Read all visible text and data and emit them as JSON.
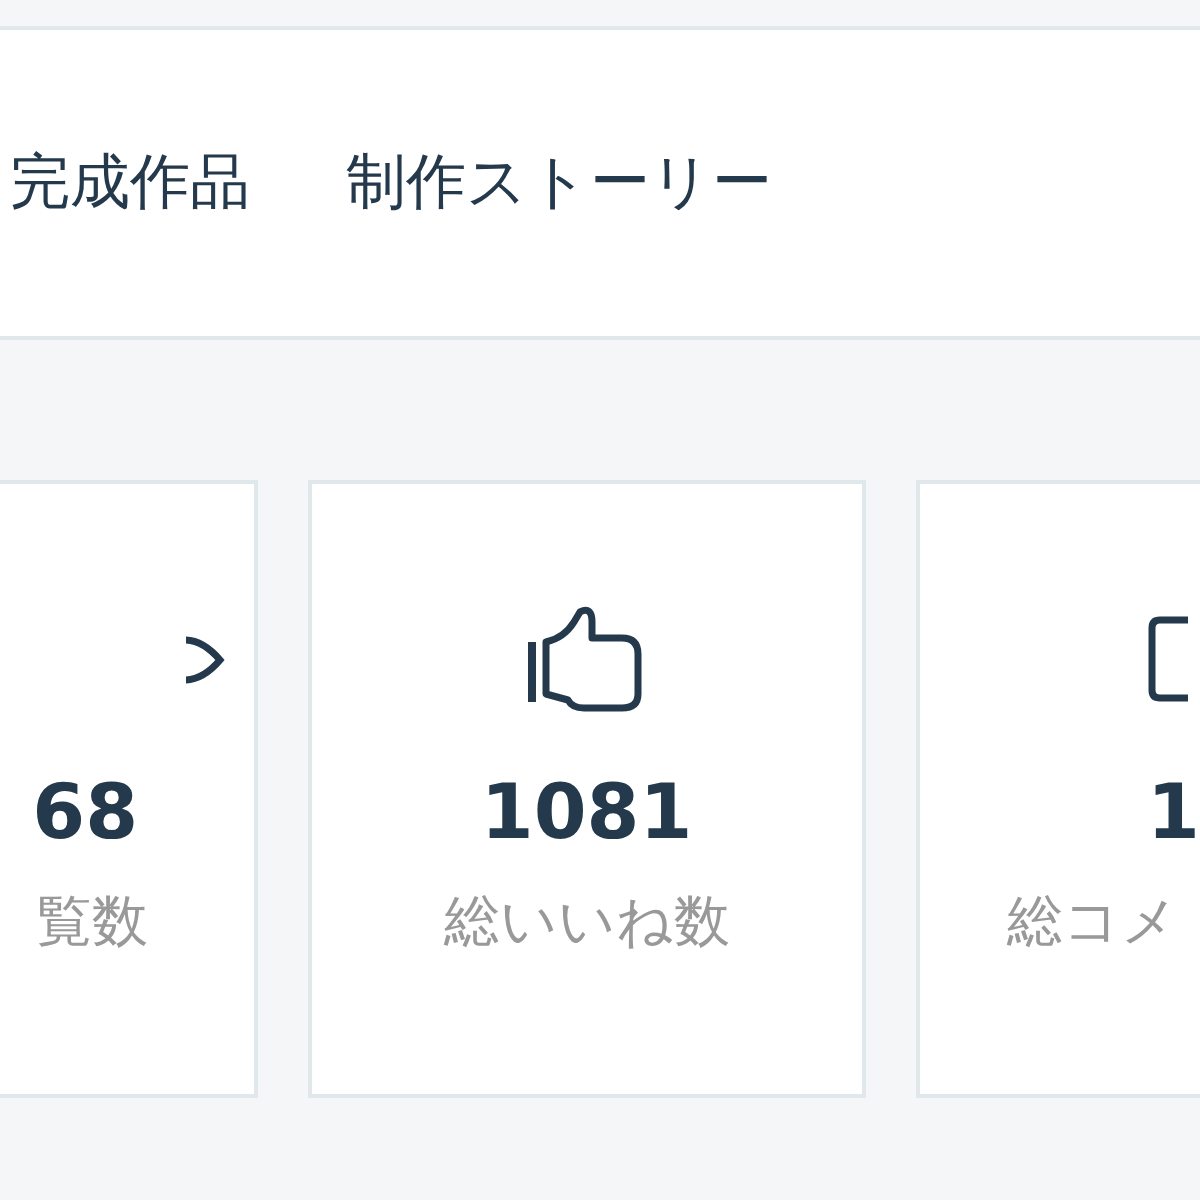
{
  "tabs": [
    {
      "label": "完成作品"
    },
    {
      "label": "制作ストーリー"
    }
  ],
  "stats": [
    {
      "kind": "views",
      "value": "68",
      "label": "覧数"
    },
    {
      "kind": "likes",
      "value": "1081",
      "label": "総いいね数"
    },
    {
      "kind": "comments",
      "value": "1",
      "label": "総コメ"
    }
  ]
}
